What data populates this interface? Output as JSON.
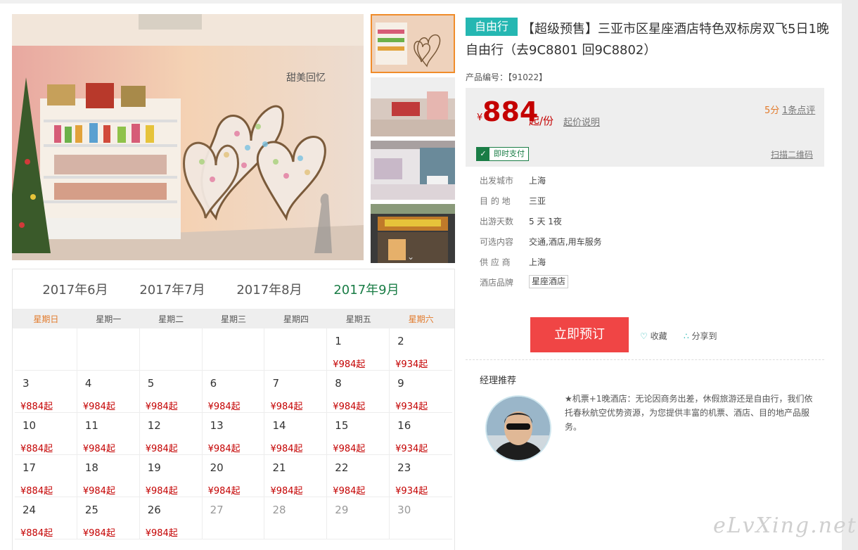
{
  "product": {
    "tag": "自由行",
    "title": "【超级预售】三亚市区星座酒店特色双标房双飞5日1晚自由行（去9C8801 回9C8802）",
    "code_label": "产品编号：【91022】"
  },
  "price": {
    "currency": "¥",
    "amount": "884",
    "unit": "起/份",
    "explain_label": "起价说明",
    "score": "5分",
    "reviews_label": "1条点评",
    "pay_badge": "即时支付",
    "qr_label": "扫描二维码"
  },
  "attributes": [
    {
      "key": "出发城市",
      "value": "上海"
    },
    {
      "key": "目 的 地",
      "value": "三亚"
    },
    {
      "key": "出游天数",
      "value": "5 天 1夜"
    },
    {
      "key": "可选内容",
      "value": "交通,酒店,用车服务"
    },
    {
      "key": "供 应 商",
      "value": "上海"
    },
    {
      "key": "酒店品牌",
      "value": "星座酒店"
    }
  ],
  "actions": {
    "book_label": "立即预订",
    "favorite_label": "收藏",
    "share_label": "分享到"
  },
  "manager": {
    "title": "经理推荐",
    "text": "★机票+1晚酒店：无论因商务出差，休假旅游还是自由行，我们依托春秋航空优势资源，为您提供丰富的机票、酒店、目的地产品服务。"
  },
  "gallery": {
    "main_caption": "甜美回忆"
  },
  "calendar": {
    "months": [
      "2017年6月",
      "2017年7月",
      "2017年8月",
      "2017年9月"
    ],
    "active_month": 3,
    "weekdays": [
      "星期日",
      "星期一",
      "星期二",
      "星期三",
      "星期四",
      "星期五",
      "星期六"
    ],
    "weeks": [
      [
        null,
        null,
        null,
        null,
        null,
        {
          "day": "1",
          "price": "¥984起"
        },
        {
          "day": "2",
          "price": "¥934起"
        }
      ],
      [
        {
          "day": "3",
          "price": "¥884起"
        },
        {
          "day": "4",
          "price": "¥984起"
        },
        {
          "day": "5",
          "price": "¥984起"
        },
        {
          "day": "6",
          "price": "¥984起"
        },
        {
          "day": "7",
          "price": "¥984起"
        },
        {
          "day": "8",
          "price": "¥984起"
        },
        {
          "day": "9",
          "price": "¥934起"
        }
      ],
      [
        {
          "day": "10",
          "price": "¥884起"
        },
        {
          "day": "11",
          "price": "¥984起"
        },
        {
          "day": "12",
          "price": "¥984起"
        },
        {
          "day": "13",
          "price": "¥984起"
        },
        {
          "day": "14",
          "price": "¥984起"
        },
        {
          "day": "15",
          "price": "¥984起"
        },
        {
          "day": "16",
          "price": "¥934起"
        }
      ],
      [
        {
          "day": "17",
          "price": "¥884起"
        },
        {
          "day": "18",
          "price": "¥984起"
        },
        {
          "day": "19",
          "price": "¥984起"
        },
        {
          "day": "20",
          "price": "¥984起"
        },
        {
          "day": "21",
          "price": "¥984起"
        },
        {
          "day": "22",
          "price": "¥984起"
        },
        {
          "day": "23",
          "price": "¥934起"
        }
      ],
      [
        {
          "day": "24",
          "price": "¥884起"
        },
        {
          "day": "25",
          "price": "¥984起"
        },
        {
          "day": "26",
          "price": "¥984起"
        },
        {
          "day": "27",
          "price": null,
          "past": true
        },
        {
          "day": "28",
          "price": null,
          "past": true
        },
        {
          "day": "29",
          "price": null,
          "past": true
        },
        {
          "day": "30",
          "price": null,
          "past": true
        }
      ]
    ]
  },
  "watermark": "eLvXing.net",
  "colors": {
    "accent_teal": "#25b7b2",
    "price_red": "#c40000",
    "book_button": "#f04545",
    "active_month_green": "#1a7d46",
    "weekend_orange": "#e27a2b"
  }
}
